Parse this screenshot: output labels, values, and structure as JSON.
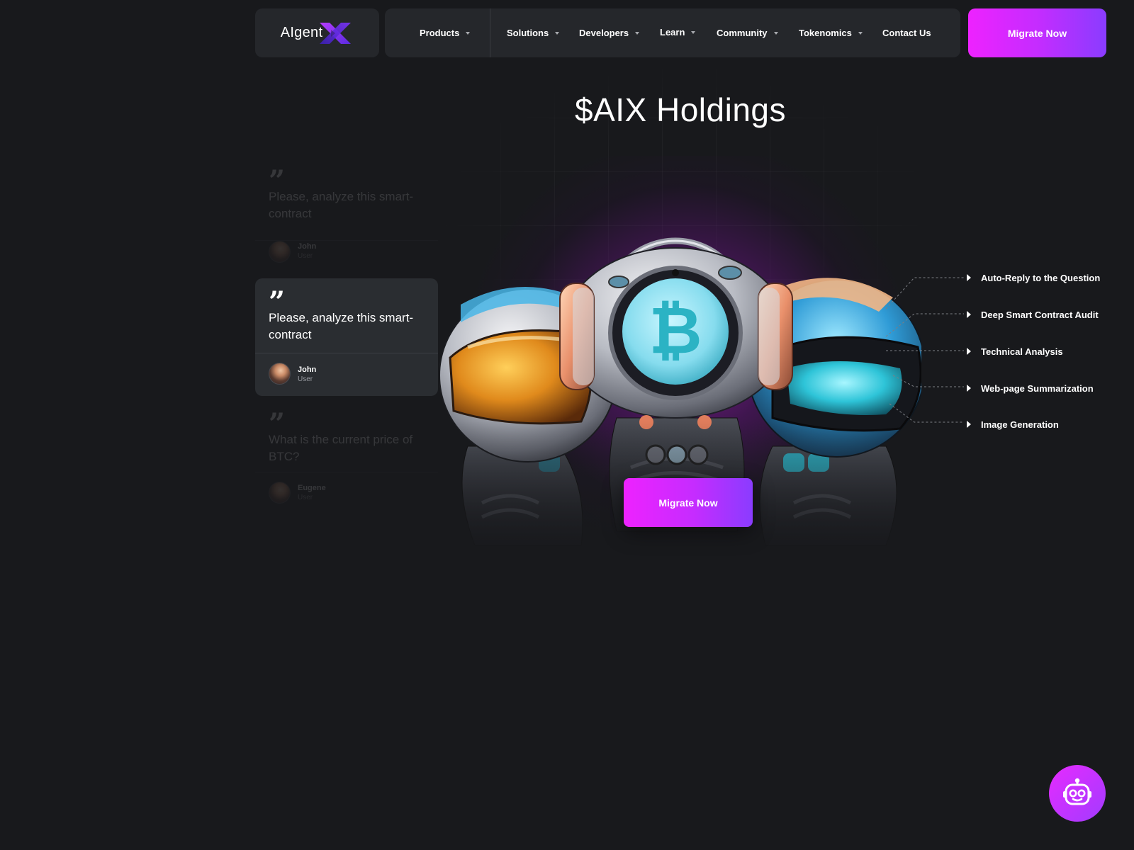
{
  "header": {
    "logo": {
      "text": "AIgent"
    },
    "nav": [
      {
        "label": "Products",
        "dropdown": true
      },
      {
        "label": "Solutions",
        "dropdown": true
      },
      {
        "label": "Developers",
        "dropdown": true
      },
      {
        "label": "Learn",
        "dropdown": true
      },
      {
        "label": "Community",
        "dropdown": true
      },
      {
        "label": "Tokenomics",
        "dropdown": true
      },
      {
        "label": "Contact Us",
        "dropdown": false
      }
    ],
    "cta_label": "Migrate Now"
  },
  "hero": {
    "title": "$AIX Holdings",
    "cta_label": "Migrate Now",
    "features": [
      "Auto-Reply to the Question",
      "Deep Smart Contract Audit",
      "Technical Analysis",
      "Web-page Summarization",
      "Image Generation"
    ]
  },
  "chat": {
    "cards": [
      {
        "text": "Please, analyze this smart-contract",
        "user": "John",
        "role": "User",
        "state": "faded"
      },
      {
        "text": "Please, analyze this smart-contract",
        "user": "John",
        "role": "User",
        "state": "active"
      },
      {
        "text": "What is the current price of BTC?",
        "user": "Eugene",
        "role": "User",
        "state": "faded"
      }
    ]
  },
  "colors": {
    "background": "#18191c",
    "panel": "#25272b",
    "accent_start": "#ee22ff",
    "accent_end": "#8a3cff",
    "bitcoin_teal": "#2bb3c4"
  },
  "icons": {
    "chatbot": "robot-face-icon",
    "quote": "quote-icon",
    "feature_marker": "triangle-right-icon",
    "dropdown": "caret-down-icon"
  }
}
